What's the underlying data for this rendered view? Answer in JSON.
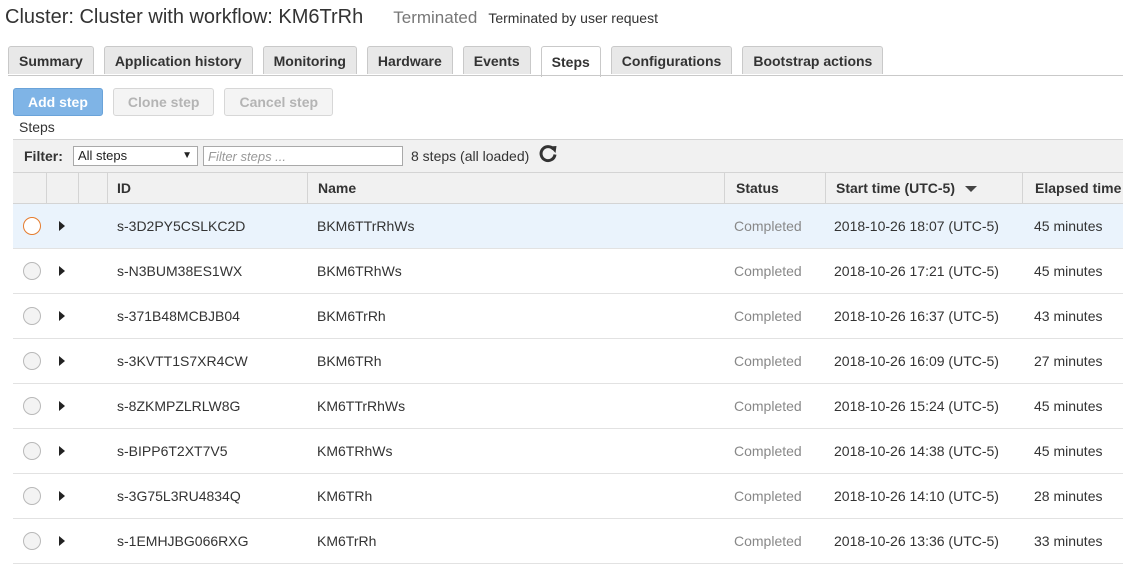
{
  "header": {
    "title": "Cluster: Cluster with workflow: KM6TrRh",
    "state": "Terminated",
    "reason": "Terminated by user request"
  },
  "tabs": [
    {
      "label": "Summary",
      "active": false
    },
    {
      "label": "Application history",
      "active": false
    },
    {
      "label": "Monitoring",
      "active": false
    },
    {
      "label": "Hardware",
      "active": false
    },
    {
      "label": "Events",
      "active": false
    },
    {
      "label": "Steps",
      "active": true
    },
    {
      "label": "Configurations",
      "active": false
    },
    {
      "label": "Bootstrap actions",
      "active": false
    }
  ],
  "actions": {
    "add_step": "Add step",
    "clone_step": "Clone step",
    "cancel_step": "Cancel step"
  },
  "section_label": "Steps",
  "filter": {
    "label": "Filter:",
    "selected": "All steps",
    "placeholder": "Filter steps ...",
    "count": "8 steps (all loaded)"
  },
  "table": {
    "columns": {
      "id": "ID",
      "name": "Name",
      "status": "Status",
      "start_time": "Start time (UTC-5)",
      "elapsed": "Elapsed time"
    },
    "rows": [
      {
        "id": "s-3D2PY5CSLKC2D",
        "name": "BKM6TTrRhWs",
        "status": "Completed",
        "start": "2018-10-26 18:07 (UTC-5)",
        "elapsed": "45 minutes",
        "selected": true
      },
      {
        "id": "s-N3BUM38ES1WX",
        "name": "BKM6TRhWs",
        "status": "Completed",
        "start": "2018-10-26 17:21 (UTC-5)",
        "elapsed": "45 minutes",
        "selected": false
      },
      {
        "id": "s-371B48MCBJB04",
        "name": "BKM6TrRh",
        "status": "Completed",
        "start": "2018-10-26 16:37 (UTC-5)",
        "elapsed": "43 minutes",
        "selected": false
      },
      {
        "id": "s-3KVTT1S7XR4CW",
        "name": "BKM6TRh",
        "status": "Completed",
        "start": "2018-10-26 16:09 (UTC-5)",
        "elapsed": "27 minutes",
        "selected": false
      },
      {
        "id": "s-8ZKMPZLRLW8G",
        "name": "KM6TTrRhWs",
        "status": "Completed",
        "start": "2018-10-26 15:24 (UTC-5)",
        "elapsed": "45 minutes",
        "selected": false
      },
      {
        "id": "s-BIPP6T2XT7V5",
        "name": "KM6TRhWs",
        "status": "Completed",
        "start": "2018-10-26 14:38 (UTC-5)",
        "elapsed": "45 minutes",
        "selected": false
      },
      {
        "id": "s-3G75L3RU4834Q",
        "name": "KM6TRh",
        "status": "Completed",
        "start": "2018-10-26 14:10 (UTC-5)",
        "elapsed": "28 minutes",
        "selected": false
      },
      {
        "id": "s-1EMHJBG066RXG",
        "name": "KM6TrRh",
        "status": "Completed",
        "start": "2018-10-26 13:36 (UTC-5)",
        "elapsed": "33 minutes",
        "selected": false
      }
    ]
  },
  "colors": {
    "accent": "#7fb4e6",
    "selected_row": "#eaf3fc",
    "selected_radio": "#e57c2e"
  }
}
